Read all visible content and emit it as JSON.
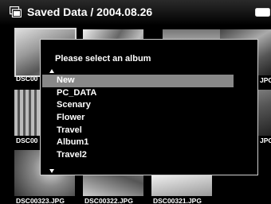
{
  "header": {
    "title": "Saved Data / 2004.08.26",
    "folder_icon": "folder-icon",
    "battery_icon": "battery-icon"
  },
  "thumbnails": [
    {
      "label": "DSC00",
      "selected": true
    },
    {
      "label": ""
    },
    {
      "label": ""
    },
    {
      "label": "JPG"
    },
    {
      "label": "DSC00"
    },
    {
      "label": "JPG"
    },
    {
      "label": "DSC00323.JPG"
    },
    {
      "label": "DSC00322.JPG"
    },
    {
      "label": "DSC00321.JPG"
    }
  ],
  "dialog": {
    "title": "Please select an album",
    "scroll_up_icon": "scroll-up-arrow-icon",
    "scroll_down_icon": "scroll-down-arrow-icon",
    "albums": [
      {
        "label": "New",
        "selected": true
      },
      {
        "label": "PC_DATA"
      },
      {
        "label": "Scenary"
      },
      {
        "label": "Flower"
      },
      {
        "label": "Travel"
      },
      {
        "label": "Album1"
      },
      {
        "label": "Travel2"
      }
    ]
  },
  "colors": {
    "background": "#000000",
    "text": "#ffffff",
    "selection_highlight": "#888888",
    "dialog_border": "#cfcfcf"
  }
}
